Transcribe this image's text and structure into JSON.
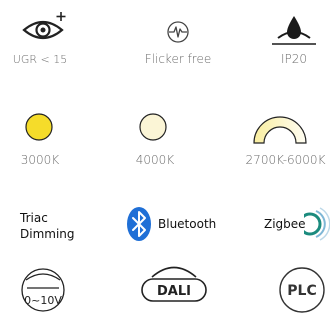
{
  "features": {
    "ugr": {
      "label": "UGR < 15",
      "icon": "eye-plus-icon"
    },
    "flicker": {
      "label": "Flicker free",
      "icon": "flicker-free-icon"
    },
    "ip": {
      "label": "IP20",
      "icon": "water-drop-icon"
    }
  },
  "color_temps": [
    {
      "label": "3000K",
      "icon": "warm-light-circle-icon",
      "color": "#f5dc2a"
    },
    {
      "label": "4000K",
      "icon": "neutral-light-circle-icon",
      "color": "#fbf5d6"
    },
    {
      "label": "2700K-6000K",
      "icon": "tunable-white-arc-icon",
      "color_from": "#f9eea0",
      "color_to": "#fffdf2"
    }
  ],
  "controls": {
    "triac": {
      "line1": "Triac",
      "line2": "Dimming"
    },
    "bluetooth": {
      "label": "Bluetooth",
      "icon": "bluetooth-icon",
      "color": "#1f6fd6"
    },
    "zigbee": {
      "label": "Zigbee",
      "icon": "zigbee-icon",
      "color": "#1b8b7e"
    }
  },
  "dimming": {
    "analog": {
      "label": "0~10V",
      "icon": "dimmer-0-10v-icon"
    },
    "dali": {
      "label": "DALI",
      "icon": "dali-icon"
    },
    "plc": {
      "label": "PLC",
      "icon": "plc-icon"
    }
  }
}
